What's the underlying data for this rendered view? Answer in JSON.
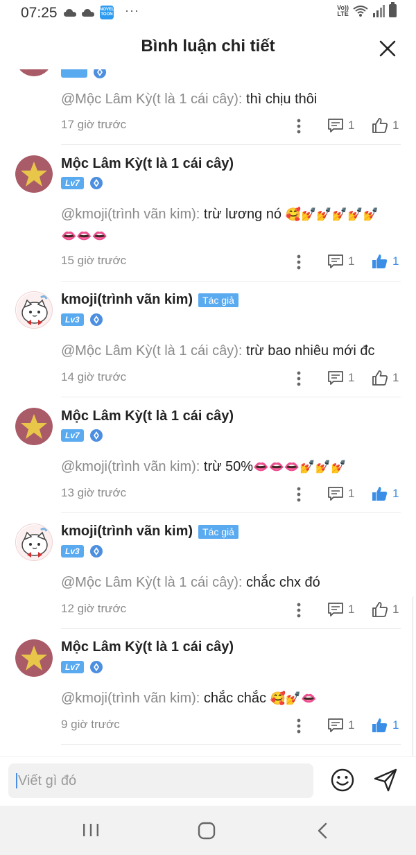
{
  "status": {
    "time": "07:25",
    "app_badge": "NOVEL TOON",
    "dots": "···",
    "volte": "Vo))\nLTE"
  },
  "header": {
    "title": "Bình luận chi tiết"
  },
  "comments": [
    {
      "mention": "@Mộc Lâm Kỳ(t là 1 cái cây): ",
      "body": "thì chịu thôi",
      "time": "17 giờ trước",
      "replies": "1",
      "likes": "1"
    },
    {
      "name": "Mộc Lâm Kỳ(t là 1 cái cây)",
      "level": "Lv7",
      "mention": "@kmoji(trình vãn kim): ",
      "body": "trừ lương nó ",
      "emoji": "🥰💅💅💅💅💅\n👄👄👄",
      "time": "15 giờ trước",
      "replies": "1",
      "likes": "1"
    },
    {
      "name": "kmoji(trình vãn kim)",
      "author_tag": "Tác giả",
      "level": "Lv3",
      "mention": "@Mộc Lâm Kỳ(t là 1 cái cây): ",
      "body": "trừ bao nhiêu mới đc",
      "time": "14 giờ trước",
      "replies": "1",
      "likes": "1"
    },
    {
      "name": "Mộc Lâm Kỳ(t là 1 cái cây)",
      "level": "Lv7",
      "mention": "@kmoji(trình vãn kim): ",
      "body": "trừ 50%",
      "emoji": "👄👄👄💅💅💅",
      "time": "13 giờ trước",
      "replies": "1",
      "likes": "1"
    },
    {
      "name": "kmoji(trình vãn kim)",
      "author_tag": "Tác giả",
      "level": "Lv3",
      "mention": "@Mộc Lâm Kỳ(t là 1 cái cây): ",
      "body": "chắc chx đó",
      "time": "12 giờ trước",
      "replies": "1",
      "likes": "1"
    },
    {
      "name": "Mộc Lâm Kỳ(t là 1 cái cây)",
      "level": "Lv7",
      "mention": "@kmoji(trình vãn kim): ",
      "body": "chắc chắc ",
      "emoji": "🥰💅👄",
      "time": "9 giờ trước",
      "replies": "1",
      "likes": "1"
    }
  ],
  "input": {
    "placeholder": "Viết gì đó"
  },
  "colors": {
    "accent": "#5aaaf0",
    "like_active": "#3a8ee6",
    "muted": "#8a8a8a"
  }
}
